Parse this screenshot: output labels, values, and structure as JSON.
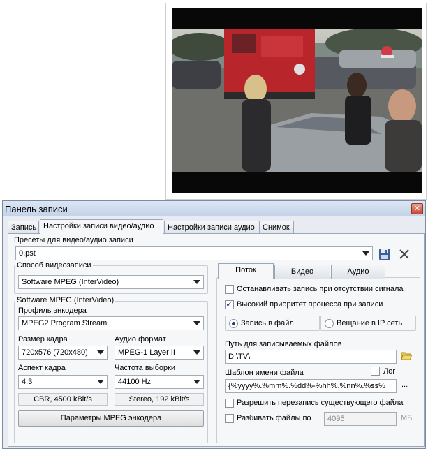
{
  "window": {
    "title": "Панель записи",
    "close_label": "✕"
  },
  "tabs": [
    {
      "label": "Запись",
      "active": false
    },
    {
      "label": "Настройки записи видео/аудио",
      "active": true
    },
    {
      "label": "Настройки записи аудио",
      "active": false
    },
    {
      "label": "Снимок",
      "active": false
    }
  ],
  "presets": {
    "label": "Пресеты для видео/аудио записи",
    "value": "0.pst",
    "save_icon": "floppy-save-icon",
    "delete_icon": "x-delete-icon"
  },
  "method": {
    "label": "Способ видеозаписи",
    "value": "Software MPEG (InterVideo)"
  },
  "encoder": {
    "group_label": "Software MPEG (InterVideo)",
    "profile_label": "Профиль энкодера",
    "profile_value": "MPEG2 Program Stream",
    "frame_size_label": "Размер кадра",
    "frame_size_value": "720x576 (720x480)",
    "audio_format_label": "Аудио формат",
    "audio_format_value": "MPEG-1 Layer II",
    "aspect_label": "Аспект кадра",
    "aspect_value": "4:3",
    "sample_rate_label": "Частота выборки",
    "sample_rate_value": "44100 Hz",
    "video_bitrate": "CBR, 4500 kBit/s",
    "audio_info": "Stereo, 192 kBit/s",
    "params_button": "Параметры MPEG энкодера"
  },
  "stream_tabs": [
    {
      "label": "Поток",
      "active": true
    },
    {
      "label": "Видео",
      "active": false
    },
    {
      "label": "Аудио",
      "active": false
    }
  ],
  "stream": {
    "stop_no_signal_label": "Останавливать запись при отсутствии сигнала",
    "stop_no_signal_checked": false,
    "high_priority_label": "Высокий приоритет процесса при записи",
    "high_priority_checked": true,
    "record_file_label": "Запись в файл",
    "record_file_selected": true,
    "broadcast_ip_label": "Вещание в IP сеть",
    "path_label": "Путь для записываемых файлов",
    "path_value": "D:\\TV\\",
    "template_label": "Шаблон имени файла",
    "log_label": "Лог",
    "log_checked": false,
    "template_value": "{%yyyy%.%mm%.%dd%-%hh%.%nn%.%ss%",
    "template_more": "...",
    "allow_overwrite_label": "Разрешить перезапись существующего файла",
    "allow_overwrite_checked": false,
    "split_files_label": "Разбивать файлы по",
    "split_files_checked": false,
    "split_size_value": "4095",
    "split_unit": "МБ"
  },
  "colors": {
    "accent": "#1a3a7a",
    "window_bg": "#e8ecf2",
    "panel_bg": "#f6f7f9",
    "folder": "#e9c548"
  }
}
